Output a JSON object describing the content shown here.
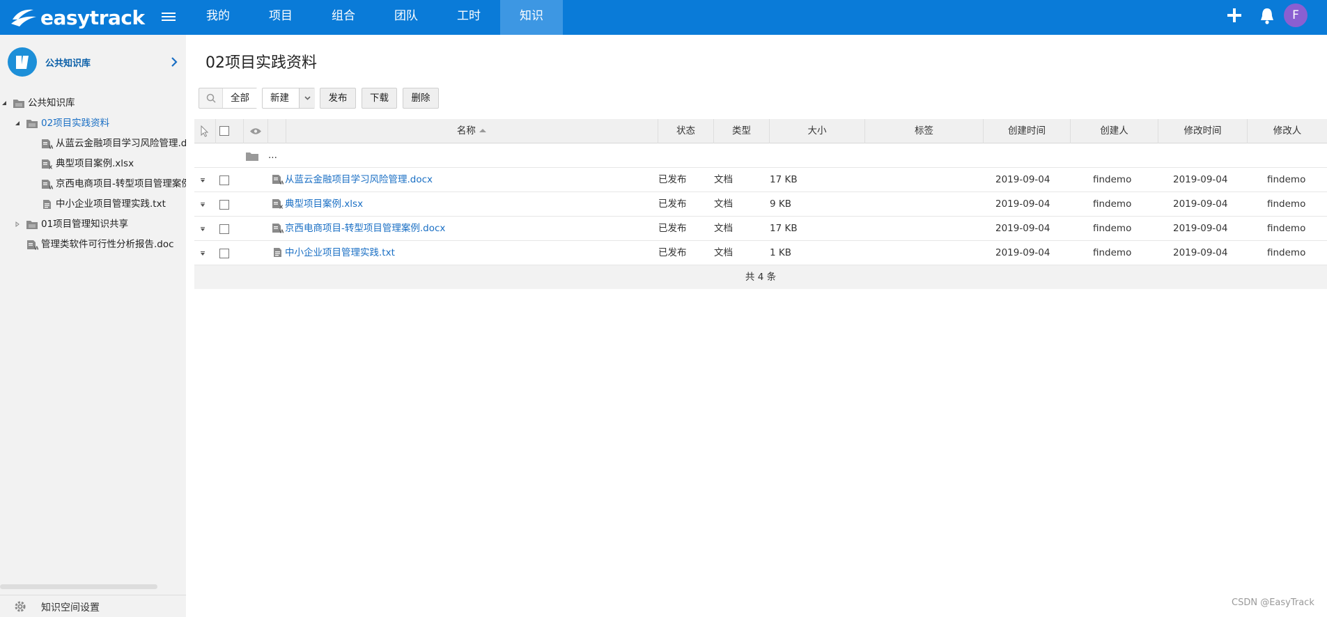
{
  "app": {
    "name": "easytrack"
  },
  "nav": [
    {
      "label": "我的"
    },
    {
      "label": "项目"
    },
    {
      "label": "组合"
    },
    {
      "label": "团队"
    },
    {
      "label": "工时"
    },
    {
      "label": "知识",
      "active": true
    }
  ],
  "user": {
    "avatar_letter": "F",
    "avatar_color": "#8a5fd1"
  },
  "colors": {
    "topbar": "#0a7bd8",
    "nav_active": "#3d97e3",
    "link": "#1a6fc4"
  },
  "sidebar": {
    "kb_title": "公共知识库",
    "tree": [
      {
        "label": "公共知识库",
        "level": 0,
        "type": "folder",
        "expanded": true
      },
      {
        "label": "02项目实践资料",
        "level": 1,
        "type": "folder",
        "expanded": true,
        "selected": true
      },
      {
        "label": "从蓝云金融项目学习风险管理.docx",
        "level": 2,
        "type": "doc"
      },
      {
        "label": "典型项目案例.xlsx",
        "level": 2,
        "type": "xls"
      },
      {
        "label": "京西电商项目-转型项目管理案例.docx",
        "level": 2,
        "type": "doc"
      },
      {
        "label": "中小企业项目管理实践.txt",
        "level": 2,
        "type": "txt"
      },
      {
        "label": "01项目管理知识共享",
        "level": 1,
        "type": "folder",
        "expanded": false
      },
      {
        "label": "管理类软件可行性分析报告.doc",
        "level": 1,
        "type": "doc"
      }
    ],
    "footer_label": "知识空间设置"
  },
  "main": {
    "title": "02项目实践资料",
    "toolbar": {
      "filter_label": "全部",
      "new_label": "新建",
      "publish_label": "发布",
      "download_label": "下载",
      "delete_label": "删除"
    },
    "columns": {
      "name": "名称",
      "status": "状态",
      "type": "类型",
      "size": "大小",
      "tags": "标签",
      "created": "创建时间",
      "creator": "创建人",
      "modified": "修改时间",
      "modifier": "修改人"
    },
    "parent_row": "...",
    "rows": [
      {
        "icon": "doc",
        "name": "从蓝云金融项目学习风险管理.docx",
        "status": "已发布",
        "type": "文档",
        "size": "17 KB",
        "tags": "",
        "created": "2019-09-04",
        "creator": "findemo",
        "modified": "2019-09-04",
        "modifier": "findemo"
      },
      {
        "icon": "xls",
        "name": "典型项目案例.xlsx",
        "status": "已发布",
        "type": "文档",
        "size": "9 KB",
        "tags": "",
        "created": "2019-09-04",
        "creator": "findemo",
        "modified": "2019-09-04",
        "modifier": "findemo"
      },
      {
        "icon": "doc",
        "name": "京西电商项目-转型项目管理案例.docx",
        "status": "已发布",
        "type": "文档",
        "size": "17 KB",
        "tags": "",
        "created": "2019-09-04",
        "creator": "findemo",
        "modified": "2019-09-04",
        "modifier": "findemo"
      },
      {
        "icon": "txt",
        "name": "中小企业项目管理实践.txt",
        "status": "已发布",
        "type": "文档",
        "size": "1 KB",
        "tags": "",
        "created": "2019-09-04",
        "creator": "findemo",
        "modified": "2019-09-04",
        "modifier": "findemo"
      }
    ],
    "footer": "共 4 条"
  },
  "watermark": "CSDN @EasyTrack"
}
